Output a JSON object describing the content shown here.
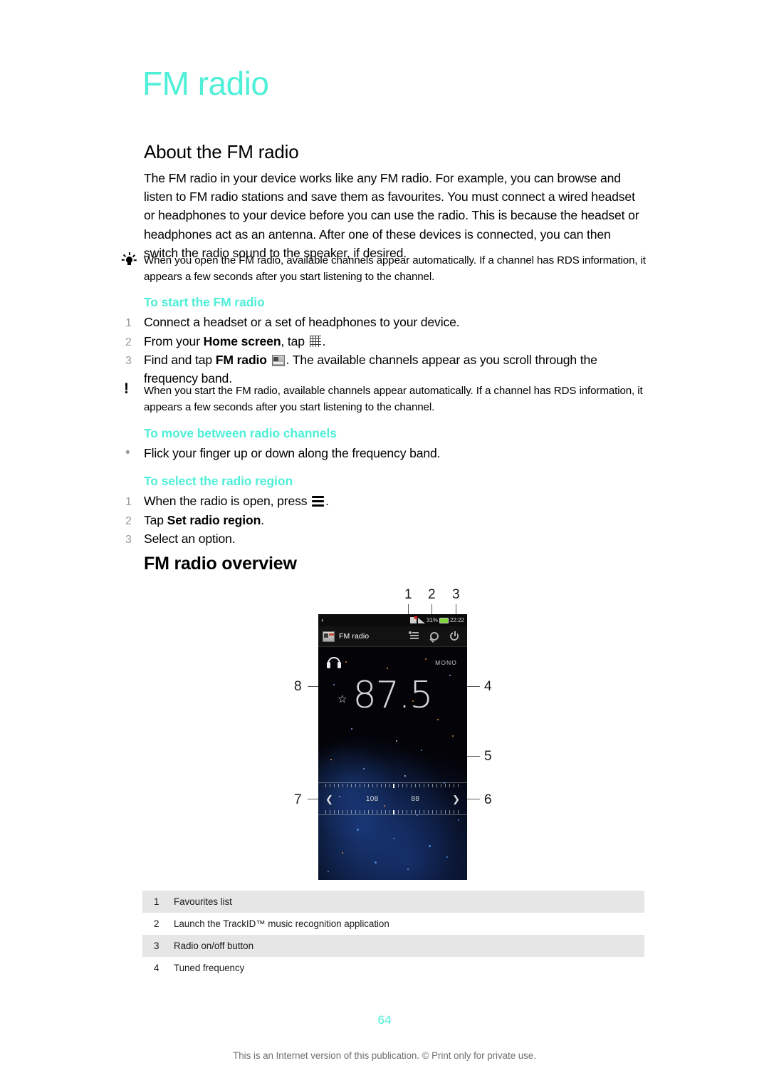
{
  "document": {
    "chapter_title": "FM radio",
    "page_number": "64",
    "footer_note": "This is an Internet version of this publication. © Print only for private use."
  },
  "about": {
    "heading": "About the FM radio",
    "paragraph": "The FM radio in your device works like any FM radio. For example, you can browse and listen to FM radio stations and save them as favourites. You must connect a wired headset or headphones to your device before you can use the radio. This is because the headset or headphones act as an antenna. After one of these devices is connected, you can then switch the radio sound to the speaker, if desired."
  },
  "notes": {
    "tip": "When you open the FM radio, available channels appear automatically. If a channel has RDS information, it appears a few seconds after you start listening to the channel.",
    "warning": "When you start the FM radio, available channels appear automatically. If a channel has RDS information, it appears a few seconds after you start listening to the channel."
  },
  "procedures": {
    "start": {
      "heading": "To start the FM radio",
      "steps": [
        {
          "num": "1",
          "text": "Connect a headset or a set of headphones to your device."
        },
        {
          "num": "2",
          "pre": "From your ",
          "bold": "Home screen",
          "post": ", tap",
          "icon": "apps-grid-icon",
          "tail": "."
        },
        {
          "num": "3",
          "pre": "Find and tap ",
          "bold": "FM radio",
          "post": "",
          "icon": "fm-radio-app-icon",
          "tail": ". The available channels appear as you scroll through the frequency band."
        }
      ]
    },
    "move": {
      "heading": "To move between radio channels",
      "bullet": "•",
      "text": "Flick your finger up or down along the frequency band."
    },
    "region": {
      "heading": "To select the radio region",
      "steps": [
        {
          "num": "1",
          "pre": "When the radio is open, press",
          "icon": "menu-icon",
          "tail": "."
        },
        {
          "num": "2",
          "pre": "Tap ",
          "bold": "Set radio region",
          "tail": "."
        },
        {
          "num": "3",
          "pre": "Select an option."
        }
      ]
    }
  },
  "overview": {
    "heading": "FM radio overview",
    "callouts": [
      "1",
      "2",
      "3",
      "4",
      "5",
      "6",
      "7",
      "8"
    ],
    "phone": {
      "status_time": "22:22",
      "status_battery": "31%",
      "app_title": "FM radio",
      "mono_label": "MONO",
      "frequency": "87.5",
      "band_left": "108",
      "band_right": "88"
    }
  },
  "legend": {
    "rows": [
      {
        "num": "1",
        "label": "Favourites list"
      },
      {
        "num": "2",
        "label": "Launch the TrackID™ music recognition application"
      },
      {
        "num": "3",
        "label": "Radio on/off button"
      },
      {
        "num": "4",
        "label": "Tuned frequency"
      }
    ]
  },
  "colors": {
    "accent": "#4FEFD8",
    "text": "#000000",
    "muted": "#9a9a9a",
    "table_shade": "#e6e6e6"
  }
}
